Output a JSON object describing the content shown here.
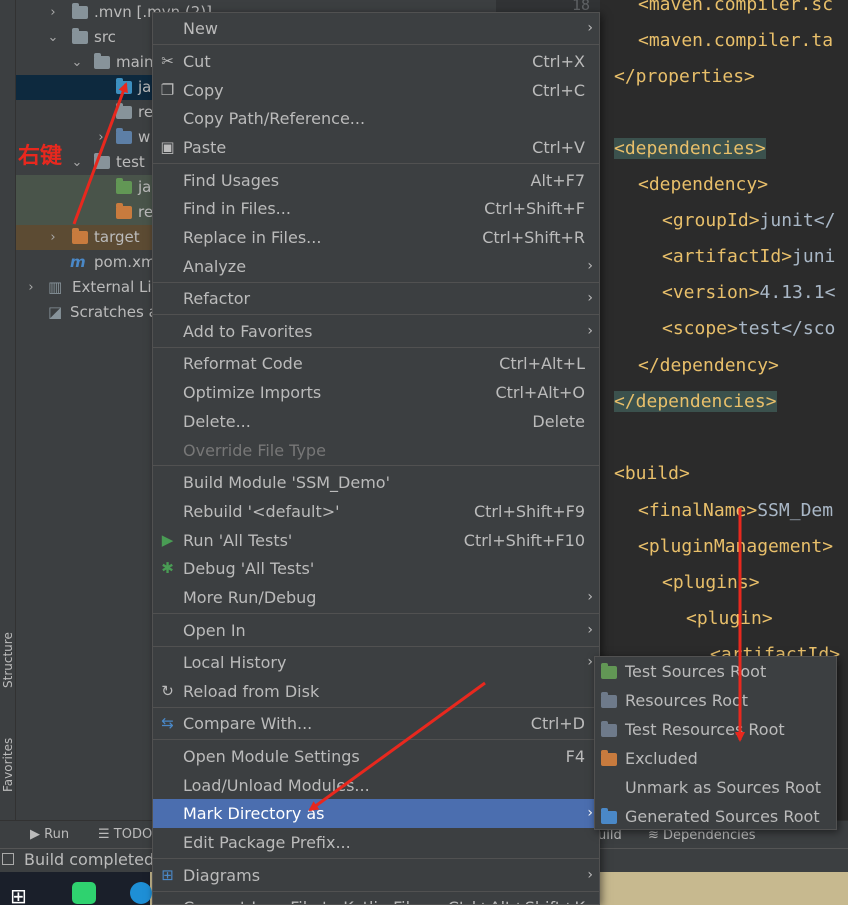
{
  "side_stripe": {
    "structure": "Structure",
    "favorites": "Favorites"
  },
  "tree": [
    {
      "label": ".mvn [.mvn (2)]",
      "icon": "folder-icon"
    },
    {
      "label": "src",
      "icon": "folder-icon"
    },
    {
      "label": "main",
      "icon": "folder-icon"
    },
    {
      "label": "ja",
      "icon": "source-folder-icon"
    },
    {
      "label": "re",
      "icon": "resources-folder-icon"
    },
    {
      "label": "w",
      "icon": "web-folder-icon"
    },
    {
      "label": "test",
      "icon": "folder-icon"
    },
    {
      "label": "ja",
      "icon": "test-folder-icon"
    },
    {
      "label": "re",
      "icon": "test-resources-folder-icon"
    },
    {
      "label": "target",
      "icon": "excluded-folder-icon"
    },
    {
      "label": "pom.xm",
      "icon": "maven-icon"
    },
    {
      "label": "External Lib",
      "icon": "library-icon"
    },
    {
      "label": "Scratches a",
      "icon": "scratches-icon"
    }
  ],
  "annotation": {
    "text": "右键"
  },
  "gutter": {
    "line_number": "18"
  },
  "code": [
    {
      "tag": "<maven.compiler.sc",
      "text": ""
    },
    {
      "tag": "<maven.compiler.ta",
      "text": ""
    },
    {
      "tag": "</properties>",
      "text": ""
    },
    {
      "tag": "<dependencies>",
      "text": ""
    },
    {
      "tag": "<dependency>",
      "text": ""
    },
    {
      "tag": "<groupId>",
      "text": "junit</"
    },
    {
      "tag": "<artifactId>",
      "text": "juni"
    },
    {
      "tag": "<version>",
      "text": "4.13.1<"
    },
    {
      "tag": "<scope>",
      "text": "test</sco"
    },
    {
      "tag": "</dependency>",
      "text": ""
    },
    {
      "tag": "</dependencies>",
      "text": ""
    },
    {
      "tag": "<build>",
      "text": ""
    },
    {
      "tag": "<finalName>",
      "text": "SSM_Dem"
    },
    {
      "tag": "<pluginManagement>",
      "text": ""
    },
    {
      "tag": "<plugins>",
      "text": ""
    },
    {
      "tag": "<plugin>",
      "text": ""
    },
    {
      "tag": "<artifactId>",
      "text": ""
    }
  ],
  "context_menu": {
    "items": [
      {
        "label": "New",
        "shortcut": "",
        "submenu": true
      },
      {
        "label": "Cut",
        "shortcut": "Ctrl+X",
        "icon": "scissors-icon"
      },
      {
        "label": "Copy",
        "shortcut": "Ctrl+C",
        "icon": "copy-icon"
      },
      {
        "label": "Copy Path/Reference...",
        "shortcut": ""
      },
      {
        "label": "Paste",
        "shortcut": "Ctrl+V",
        "icon": "paste-icon"
      },
      {
        "label": "Find Usages",
        "shortcut": "Alt+F7"
      },
      {
        "label": "Find in Files...",
        "shortcut": "Ctrl+Shift+F"
      },
      {
        "label": "Replace in Files...",
        "shortcut": "Ctrl+Shift+R"
      },
      {
        "label": "Analyze",
        "shortcut": "",
        "submenu": true
      },
      {
        "label": "Refactor",
        "shortcut": "",
        "submenu": true
      },
      {
        "label": "Add to Favorites",
        "shortcut": "",
        "submenu": true
      },
      {
        "label": "Reformat Code",
        "shortcut": "Ctrl+Alt+L"
      },
      {
        "label": "Optimize Imports",
        "shortcut": "Ctrl+Alt+O"
      },
      {
        "label": "Delete...",
        "shortcut": "Delete"
      },
      {
        "label": "Override File Type",
        "shortcut": "",
        "disabled": true
      },
      {
        "label": "Build Module 'SSM_Demo'",
        "shortcut": ""
      },
      {
        "label": "Rebuild '<default>'",
        "shortcut": "Ctrl+Shift+F9"
      },
      {
        "label": "Run 'All Tests'",
        "shortcut": "Ctrl+Shift+F10",
        "icon": "run-icon"
      },
      {
        "label": "Debug 'All Tests'",
        "shortcut": "",
        "icon": "debug-icon"
      },
      {
        "label": "More Run/Debug",
        "shortcut": "",
        "submenu": true
      },
      {
        "label": "Open In",
        "shortcut": "",
        "submenu": true
      },
      {
        "label": "Local History",
        "shortcut": "",
        "submenu": true
      },
      {
        "label": "Reload from Disk",
        "shortcut": "",
        "icon": "reload-icon"
      },
      {
        "label": "Compare With...",
        "shortcut": "Ctrl+D",
        "icon": "compare-icon"
      },
      {
        "label": "Open Module Settings",
        "shortcut": "F4"
      },
      {
        "label": "Load/Unload Modules...",
        "shortcut": ""
      },
      {
        "label": "Mark Directory as",
        "shortcut": "",
        "submenu": true,
        "active": true
      },
      {
        "label": "Edit Package Prefix...",
        "shortcut": ""
      },
      {
        "label": "Diagrams",
        "shortcut": "",
        "submenu": true,
        "icon": "diagram-icon"
      },
      {
        "label": "Convert Java File to Kotlin File",
        "shortcut": "Ctrl+Alt+Shift+K"
      }
    ]
  },
  "submenu": {
    "items": [
      {
        "label": "Test Sources Root",
        "color": "#629755"
      },
      {
        "label": "Resources Root",
        "color": "#6e7a8a"
      },
      {
        "label": "Test Resources Root",
        "color": "#6e7a8a"
      },
      {
        "label": "Excluded",
        "color": "#c87b3e"
      },
      {
        "label": "Unmark as Sources Root",
        "color": ""
      },
      {
        "label": "Generated Sources Root",
        "color": "#4a88c7"
      }
    ]
  },
  "tool_bar": {
    "run": "Run",
    "todo": "TODO",
    "build": "uild",
    "dependencies": "Dependencies"
  },
  "status_bar": {
    "text": "Build completed"
  },
  "colors": {
    "accent": "#4b6eaf",
    "arrow": "#e8281e"
  }
}
